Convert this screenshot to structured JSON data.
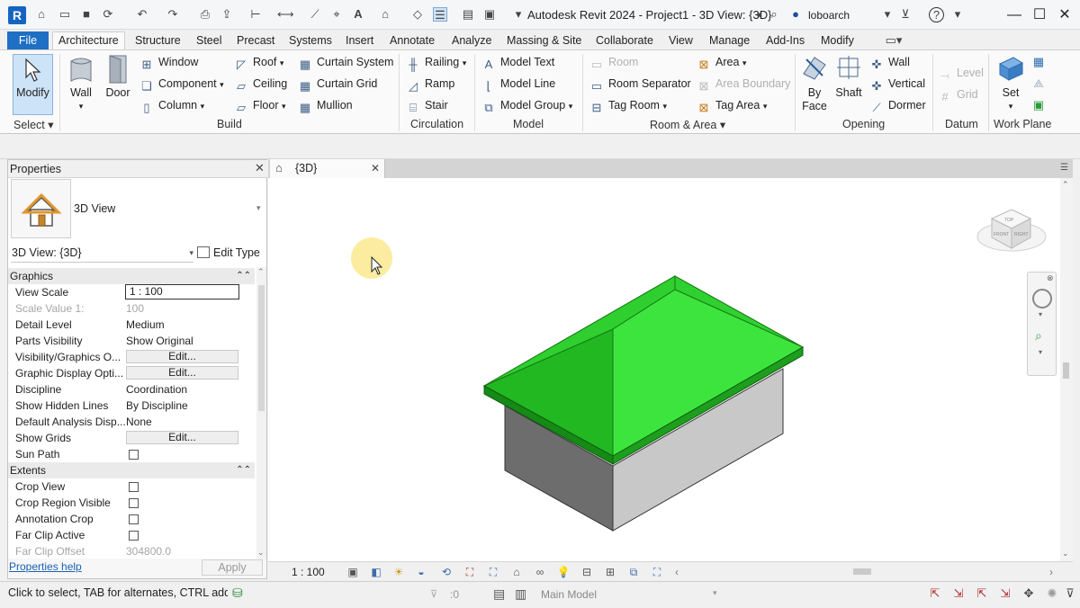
{
  "window": {
    "title": "Autodesk Revit 2024 - Project1 - 3D View: {3D}",
    "user": "loboarch",
    "logo": "R"
  },
  "ribbon_tabs": [
    "File",
    "Architecture",
    "Structure",
    "Steel",
    "Precast",
    "Systems",
    "Insert",
    "Annotate",
    "Analyze",
    "Massing & Site",
    "Collaborate",
    "View",
    "Manage",
    "Add-Ins",
    "Modify"
  ],
  "active_tab": "Architecture",
  "ribbon": {
    "select": {
      "modify": "Modify",
      "label": "Select"
    },
    "build": {
      "label": "Build",
      "wall": "Wall",
      "door": "Door",
      "window": "Window",
      "component": "Component",
      "column": "Column",
      "roof": "Roof",
      "ceiling": "Ceiling",
      "floor": "Floor",
      "curtain_system": "Curtain System",
      "curtain_grid": "Curtain Grid",
      "mullion": "Mullion"
    },
    "circulation": {
      "label": "Circulation",
      "railing": "Railing",
      "ramp": "Ramp",
      "stair": "Stair"
    },
    "model": {
      "label": "Model",
      "model_text": "Model Text",
      "model_line": "Model Line",
      "model_group": "Model Group"
    },
    "room_area": {
      "label": "Room & Area",
      "room": "Room",
      "room_separator": "Room Separator",
      "tag_room": "Tag Room",
      "area": "Area",
      "area_boundary": "Area Boundary",
      "tag_area": "Tag Area"
    },
    "opening": {
      "label": "Opening",
      "by": "By",
      "face": "Face",
      "shaft": "Shaft",
      "wall": "Wall",
      "vertical": "Vertical",
      "dormer": "Dormer"
    },
    "datum": {
      "label": "Datum",
      "level": "Level",
      "grid": "Grid"
    },
    "work_plane": {
      "label": "Work Plane",
      "set": "Set"
    }
  },
  "properties": {
    "title": "Properties",
    "type_name": "3D View",
    "view_selector": "3D View: {3D}",
    "edit_type": "Edit Type",
    "groups": {
      "graphics": "Graphics",
      "extents": "Extents"
    },
    "rows": [
      {
        "name": "View Scale",
        "value": "1 : 100"
      },
      {
        "name": "Scale Value    1:",
        "value": "100"
      },
      {
        "name": "Detail Level",
        "value": "Medium"
      },
      {
        "name": "Parts Visibility",
        "value": "Show Original"
      },
      {
        "name": "Visibility/Graphics O...",
        "value": "Edit..."
      },
      {
        "name": "Graphic Display Opti...",
        "value": "Edit..."
      },
      {
        "name": "Discipline",
        "value": "Coordination"
      },
      {
        "name": "Show Hidden Lines",
        "value": "By Discipline"
      },
      {
        "name": "Default Analysis Disp...",
        "value": "None"
      },
      {
        "name": "Show Grids",
        "value": "Edit..."
      },
      {
        "name": "Sun Path",
        "value": ""
      },
      {
        "name": "Crop View",
        "value": ""
      },
      {
        "name": "Crop Region Visible",
        "value": ""
      },
      {
        "name": "Annotation Crop",
        "value": ""
      },
      {
        "name": "Far Clip Active",
        "value": ""
      },
      {
        "name": "Far Clip Offset",
        "value": "304800.0"
      }
    ],
    "help": "Properties help",
    "apply": "Apply"
  },
  "view": {
    "tab_label": "{3D}",
    "scale": "1 : 100",
    "viewcube_top": "TOP",
    "viewcube_front": "FRONT",
    "viewcube_right": "RIGHT"
  },
  "status": {
    "hint": "Click to select, TAB for alternates, CTRL adds, SHIFT unselects.",
    "selection_count": ":0",
    "model": "Main Model"
  },
  "colors": {
    "roof_light": "#39e039",
    "roof_mid": "#22b822",
    "roof_dark": "#168a16",
    "wall_front": "#c8c8c8",
    "wall_side": "#6d6d6d",
    "file_tab": "#1f6fc4",
    "cursor_highlight": "#fbe98f"
  }
}
